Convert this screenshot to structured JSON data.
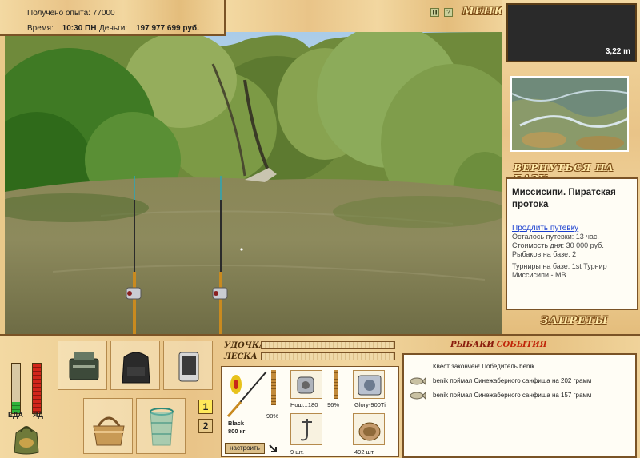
{
  "info": {
    "xp_label": "Получено опыта:",
    "xp_value": "77000",
    "time_label": "Время:",
    "time_value": "10:30 ПН",
    "money_label": "Деньги:",
    "money_value": "197 977 699 руб."
  },
  "topbar": {
    "pause_icon": "pause-icon",
    "help_glyph": "?",
    "menu_label": "МЕНЮ"
  },
  "right": {
    "depth_value": "3,22 m",
    "back_to_base": "ВЕРНУТЬСЯ НА БАЗУ",
    "location_title": "Миссисипи. Пиратская протока",
    "extend_link": "Продлить путевку",
    "lines": [
      "Осталось путевки: 13 час.",
      "Стоимость дня: 30 000 руб.",
      "Рыбаков на базе: 2",
      "Турниры на базе: 1st Турнир Миссисипи - MB"
    ],
    "bans_label": "ЗАПРЕТЫ"
  },
  "bottom": {
    "meter_food_label": "ЕДА",
    "meter_yad_label": "ЯД",
    "food_level": 0.22,
    "yad_level": 1.0,
    "tab1": "1",
    "tab2": "2",
    "rod_label": "УДОЧКА",
    "line_label": "ЛЕСКА",
    "gear": {
      "rod_name": "Black",
      "rod_capacity": "800 кг",
      "rod_pct": "98%",
      "reel_text": "Нош...180",
      "reel_pct": "96%",
      "line_name": "Glory-900Ti",
      "hooks_count": "9 шт.",
      "bait_count": "492 шт.",
      "adjust_label": "настроить"
    },
    "log": {
      "title_a": "РЫБАКИ",
      "title_b": "СОБЫТИЯ",
      "lines": [
        "Квест закончен! Победитель benik",
        "benik поймал Синежаберного санфиша на 202 грамм",
        "benik поймал Синежаберного санфиша на 157 грамм"
      ]
    }
  },
  "colors": {
    "accent_red": "#c0260a",
    "link_blue": "#1a3fd0",
    "meter_green": "#2fb33a",
    "meter_red": "#d2261a"
  }
}
